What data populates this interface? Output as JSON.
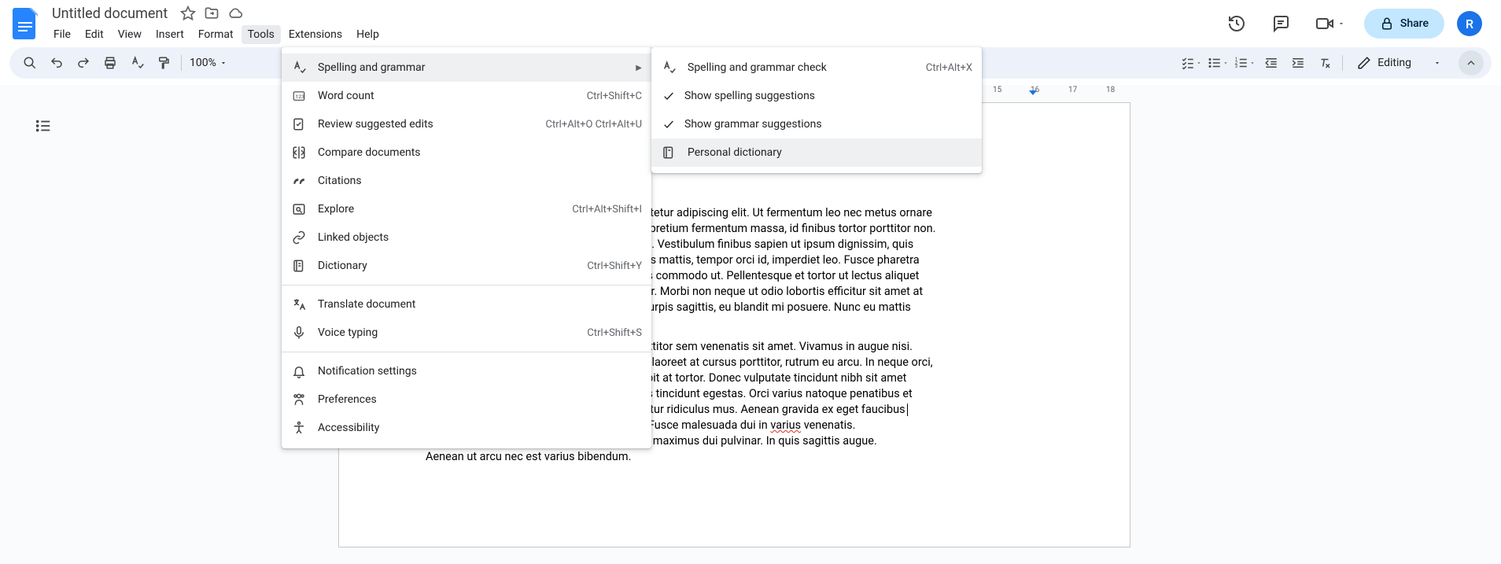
{
  "header": {
    "title": "Untitled document",
    "avatar_letter": "R",
    "share_label": "Share"
  },
  "menubar": {
    "items": [
      "File",
      "Edit",
      "View",
      "Insert",
      "Format",
      "Tools",
      "Extensions",
      "Help"
    ],
    "active_index": 5
  },
  "toolbar": {
    "zoom": "100%",
    "editing_label": "Editing"
  },
  "tools_menu": {
    "items": [
      {
        "label": "Spelling and grammar",
        "icon": "spellcheck",
        "has_submenu": true,
        "highlighted": true
      },
      {
        "label": "Word count",
        "icon": "numbers",
        "shortcut": "Ctrl+Shift+C"
      },
      {
        "label": "Review suggested edits",
        "icon": "review",
        "shortcut": "Ctrl+Alt+O Ctrl+Alt+U"
      },
      {
        "label": "Compare documents",
        "icon": "compare"
      },
      {
        "label": "Citations",
        "icon": "quote"
      },
      {
        "label": "Explore",
        "icon": "explore",
        "shortcut": "Ctrl+Alt+Shift+I"
      },
      {
        "label": "Linked objects",
        "icon": "link"
      },
      {
        "label": "Dictionary",
        "icon": "dictionary",
        "shortcut": "Ctrl+Shift+Y"
      },
      {
        "sep": true
      },
      {
        "label": "Translate document",
        "icon": "translate"
      },
      {
        "label": "Voice typing",
        "icon": "mic",
        "shortcut": "Ctrl+Shift+S"
      },
      {
        "sep": true
      },
      {
        "label": "Notification settings",
        "icon": "bell"
      },
      {
        "label": "Preferences",
        "icon": "prefs"
      },
      {
        "label": "Accessibility",
        "icon": "accessibility"
      }
    ]
  },
  "submenu": {
    "items": [
      {
        "label": "Spelling and grammar check",
        "icon": "spellcheck",
        "shortcut": "Ctrl+Alt+X"
      },
      {
        "label": "Show spelling suggestions",
        "checked": true
      },
      {
        "label": "Show grammar suggestions",
        "checked": true
      },
      {
        "label": "Personal dictionary",
        "icon": "book",
        "highlighted": true
      }
    ]
  },
  "ruler": {
    "ticks": [
      "15",
      "16",
      "17",
      "18"
    ]
  },
  "document": {
    "p1_a": "ectetur adipiscing elit. Ut fermentum leo nec metus ornare",
    "p1_b": "is pretium fermentum massa, id finibus tortor porttitor non.",
    "p1_c": "rat. Vestibulum finibus sapien ut ipsum dignissim, quis",
    "p1_d": "cus mattis, tempor orci id, imperdiet leo. Fusce pharetra",
    "p1_e": "lus commodo ut. Pellentesque et tortor ut lectus aliquet",
    "p1_f": "por. Morbi non neque ut odio lobortis efficitur sit amet at",
    "p1_g": "t turpis sagittis, eu blandit mi posuere. Nunc eu mattis",
    "p2_a": "orttitor sem venenatis sit amet. Vivamus in augue nisi.",
    "p2_b": "is, laoreet at cursus porttitor, rutrum eu arcu. In neque orci,",
    "p2_c": "cipit at tortor. Donec vulputate tincidunt nibh sit amet",
    "p2_d": "uis tincidunt egestas. Orci varius natoque penatibus et",
    "p2_e": "cetur ridiculus mus. Aenean gravida ex eget faucibus",
    "p2_f_pre": "hendrerit. Aliquam sagittis faucibus finibus. Fusce malesuada dui in ",
    "p2_f_err": "varius",
    "p2_f_post": " venenatis.",
    "p2_g": "Aliquam hendrerit turpis ac felis dignissim, a maximus dui pulvinar. In quis sagittis augue.",
    "p2_h": "Aenean ut arcu nec est varius bibendum."
  }
}
